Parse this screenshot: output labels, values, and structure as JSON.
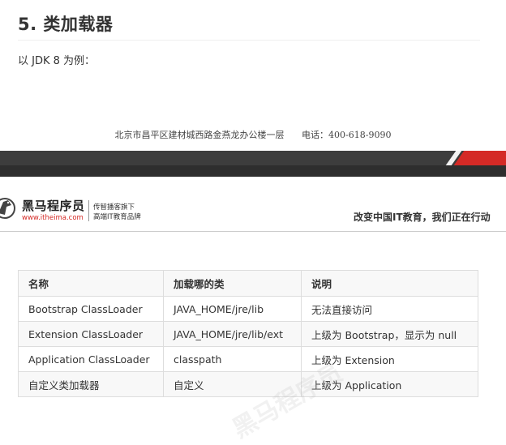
{
  "section": {
    "heading": "5. 类加载器",
    "intro": "以 JDK 8 为例："
  },
  "page_footer": {
    "address": "北京市昌平区建材城西路金燕龙办公楼一层",
    "phone": "电话：400-618-9090"
  },
  "brand": {
    "name": "黑马程序员",
    "url": "www.itheima.com",
    "tagline_1": "传智播客旗下",
    "tagline_2": "高端IT教育品牌",
    "slogan": "改变中国IT教育，我们正在行动",
    "accent_color": "#d42a26"
  },
  "table": {
    "headers": [
      "名称",
      "加载哪的类",
      "说明"
    ],
    "rows": [
      [
        "Bootstrap ClassLoader",
        "JAVA_HOME/jre/lib",
        "无法直接访问"
      ],
      [
        "Extension ClassLoader",
        "JAVA_HOME/jre/lib/ext",
        "上级为 Bootstrap，显示为 null"
      ],
      [
        "Application ClassLoader",
        "classpath",
        "上级为 Extension"
      ],
      [
        "自定义类加载器",
        "自定义",
        "上级为 Application"
      ]
    ]
  },
  "watermark": "黑马程序员"
}
